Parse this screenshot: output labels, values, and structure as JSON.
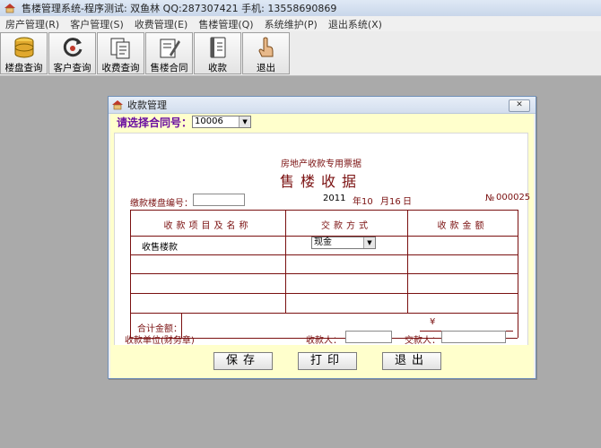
{
  "window": {
    "title": "售楼管理系统-程序测试: 双鱼林 QQ:287307421 手机: 13558690869"
  },
  "menu": [
    {
      "label": "房产管理(R)"
    },
    {
      "label": "客户管理(S)"
    },
    {
      "label": "收费管理(E)"
    },
    {
      "label": "售楼管理(Q)"
    },
    {
      "label": "系统维护(P)"
    },
    {
      "label": "退出系统(X)"
    }
  ],
  "toolbar": [
    {
      "label": "楼盘查询",
      "icon": "database-icon"
    },
    {
      "label": "客户查询",
      "icon": "refresh-search-icon"
    },
    {
      "label": "收费查询",
      "icon": "documents-icon"
    },
    {
      "label": "售楼合同",
      "icon": "contract-pen-icon"
    },
    {
      "label": "收款",
      "icon": "ledger-icon"
    },
    {
      "label": "退出",
      "icon": "hand-exit-icon"
    }
  ],
  "dialog": {
    "title": "收款管理",
    "close": "✕",
    "contract_label": "请选择合同号：",
    "contract_value": "10006",
    "receipt": {
      "caption": "房地产收款专用票据",
      "title": "售楼收据",
      "building_label": "缴款楼盘编号：",
      "building_value": "",
      "year": "2011",
      "month_label": "年10",
      "day_label": "月16",
      "day_suffix": "日",
      "no_label": "№",
      "no_value": "000025",
      "col_item": "收款项目及名称",
      "col_method": "交款方式",
      "col_amount": "收款金额",
      "item1": "收售楼款",
      "method_value": "现金",
      "total_label": "合计金额：",
      "currency": "¥",
      "unit_label": "收款单位(财务章)",
      "payee_label": "收款人：",
      "payee_value": "",
      "payer_label": "交款人：",
      "payer_value": ""
    },
    "buttons": {
      "save": "保存",
      "print": "打印",
      "exit": "退出"
    }
  },
  "colors": {
    "receipt_red": "#7a1010",
    "contract_label_purple": "#6a0da0",
    "panel_yellow": "#ffffcc",
    "workspace_gray": "#aaaaaa"
  }
}
